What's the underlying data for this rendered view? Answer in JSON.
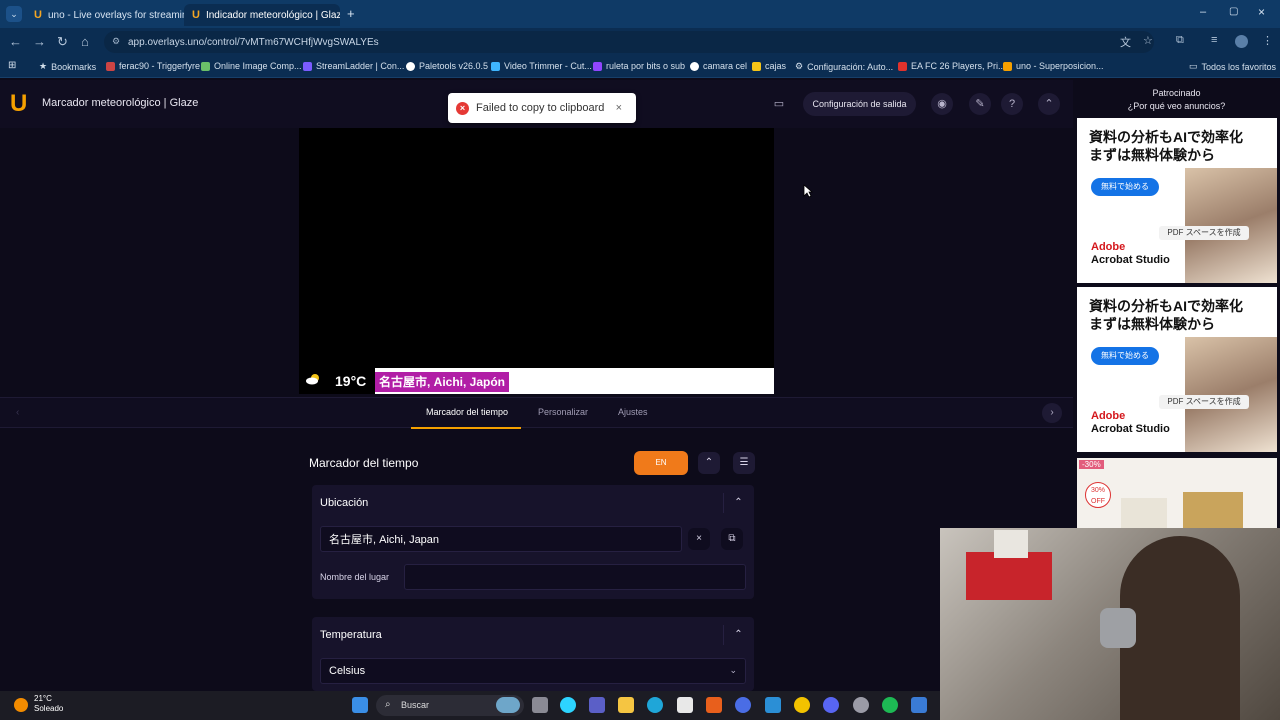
{
  "browser": {
    "tabs": [
      {
        "label": "uno - Live overlays for streamin"
      },
      {
        "label": "Indicador meteorológico | Glaz"
      }
    ],
    "url": "app.overlays.uno/control/7vMTm67WCHfjWvgSWALYEs",
    "bookmarks": [
      "Bookmarks",
      "ferac90 - Triggerfyre",
      "Online Image Comp...",
      "StreamLadder | Con...",
      "Paletools v26.0.5",
      "Video Trimmer - Cut...",
      "ruleta por bits o sub",
      "camara cel",
      "cajas",
      "Configuración: Auto...",
      "EA FC 26 Players, Pri...",
      "uno - Superposicion..."
    ],
    "all_bookmarks": "Todos los favoritos"
  },
  "app": {
    "title": "Marcador meteorológico | Glaze",
    "toast": "Failed to copy to clipboard",
    "output_config": "Configuración de salida"
  },
  "preview": {
    "temperature": "19°C",
    "location": "名古屋市, Aichi, Japón"
  },
  "tabs": {
    "weather": "Marcador del tiempo",
    "customize": "Personalizar",
    "settings": "Ajustes"
  },
  "panel": {
    "title": "Marcador del tiempo",
    "lang": "EN",
    "location_section": "Ubicación",
    "location_value": "名古屋市, Aichi, Japan",
    "place_name_label": "Nombre del lugar",
    "place_name_value": "",
    "temp_section": "Temperatura",
    "unit": "Celsius"
  },
  "ads": {
    "sponsored": "Patrocinado",
    "why": "¿Por qué veo anuncios?",
    "headline1": "資料の分析もAIで効率化",
    "headline2": "まずは無料体験から",
    "cta": "無料で始める",
    "pdf": "PDF スペースを作成",
    "brand1": "Adobe",
    "brand2": "Acrobat Studio",
    "ad3_badge": "-30%",
    "ad3_off1": "30%",
    "ad3_off2": "OFF"
  },
  "taskbar": {
    "temp": "21°C",
    "weather": "Soleado",
    "search": "Buscar"
  }
}
